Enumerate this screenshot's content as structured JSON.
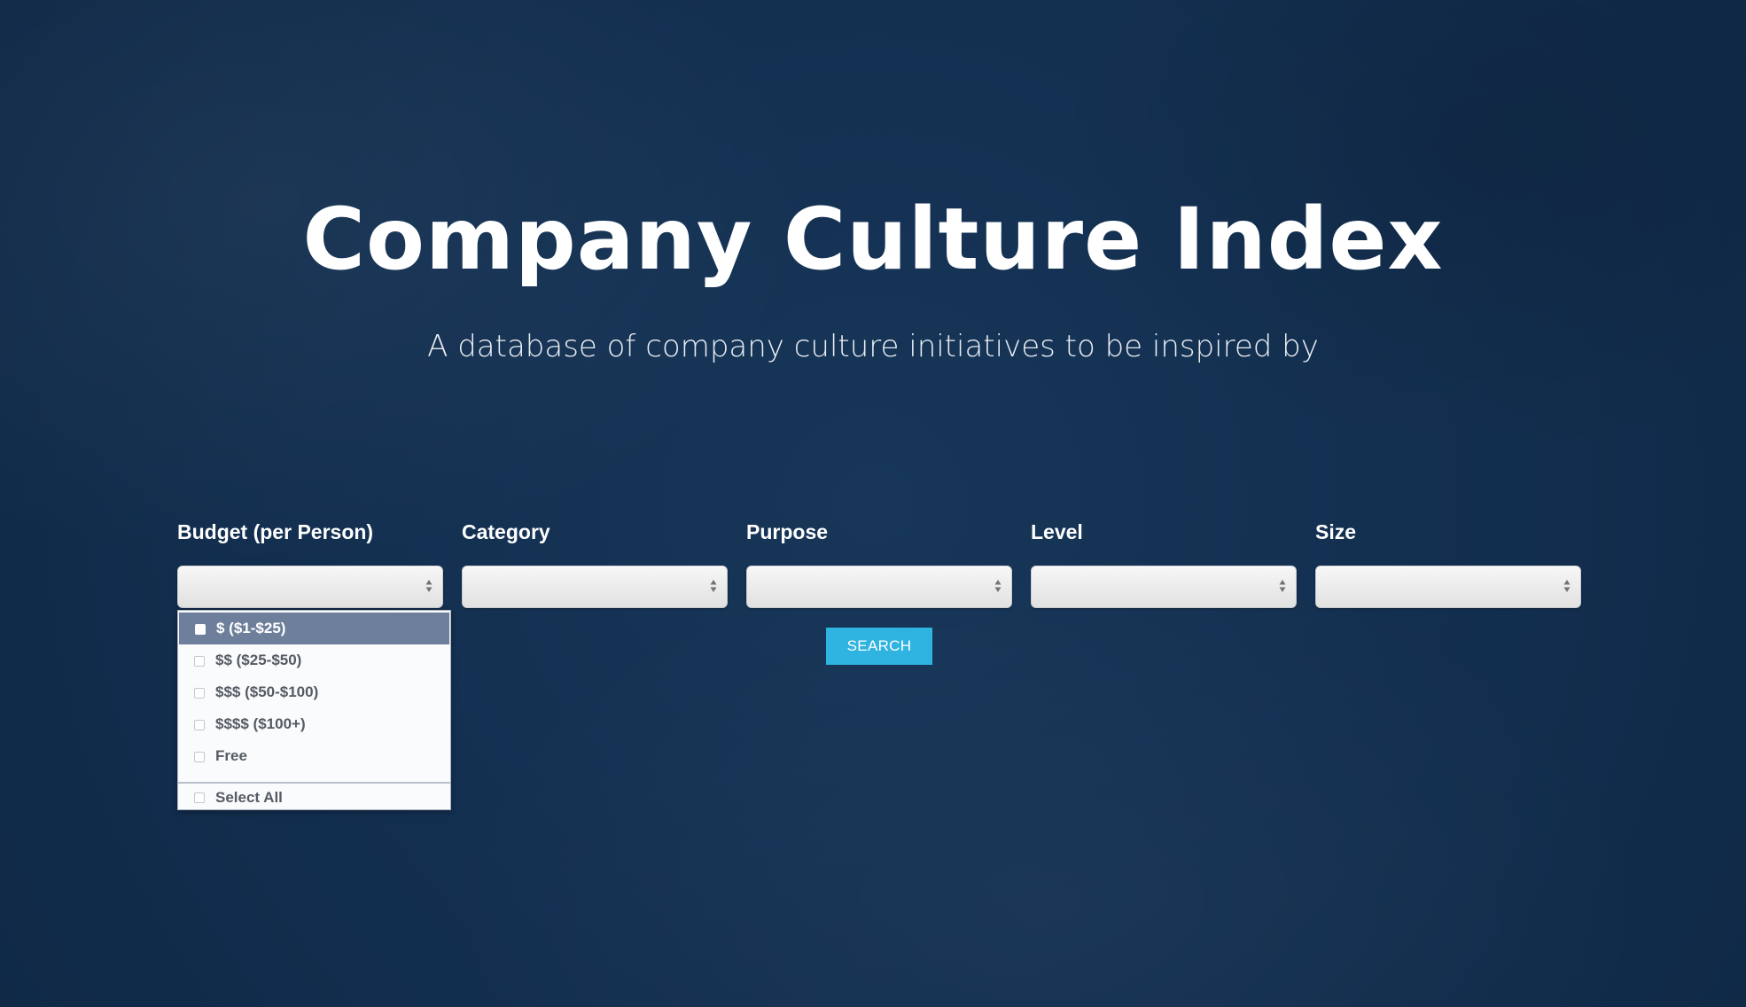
{
  "hero": {
    "title": "Company Culture Index",
    "subtitle": "A database of company culture initiatives to be inspired by"
  },
  "filters": [
    {
      "label": "Budget (per Person)",
      "selected_value": "",
      "open": true
    },
    {
      "label": "Category",
      "selected_value": ""
    },
    {
      "label": "Purpose",
      "selected_value": ""
    },
    {
      "label": "Level",
      "selected_value": ""
    },
    {
      "label": "Size",
      "selected_value": ""
    }
  ],
  "budget_dropdown": {
    "options": [
      {
        "label": "$ ($1-$25)",
        "highlighted": true
      },
      {
        "label": "$$ ($25-$50)",
        "highlighted": false
      },
      {
        "label": "$$$ ($50-$100)",
        "highlighted": false
      },
      {
        "label": "$$$$ ($100+)",
        "highlighted": false
      },
      {
        "label": "Free",
        "highlighted": false
      }
    ],
    "select_all_label": "Select All"
  },
  "search": {
    "label": "SEARCH"
  },
  "colors": {
    "background": "#132f50",
    "search_button": "#2fb3e0",
    "highlight": "#6d7f9a"
  },
  "icons": {
    "select_arrow": "updown-arrows-icon",
    "option_checkbox": "checkbox-icon"
  }
}
